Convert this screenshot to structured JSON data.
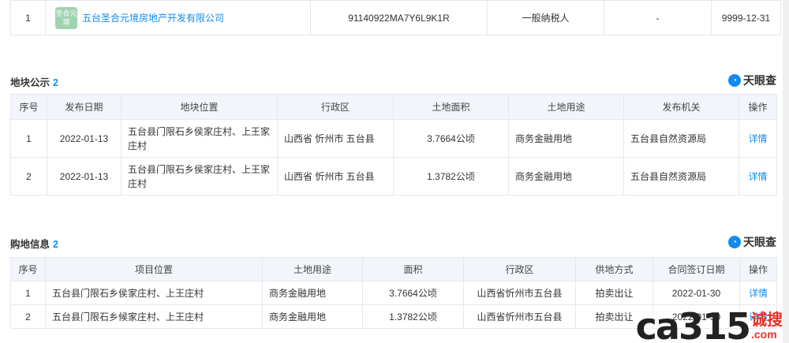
{
  "top_row": {
    "index": "1",
    "logo_text": "圣合元境",
    "company": "五台圣合元境房地产开发有限公司",
    "credit_code": "91140922MA7Y6L9K1R",
    "taxpayer_type": "一般纳税人",
    "col4": "-",
    "valid_until": "9999-12-31"
  },
  "brand": {
    "name": "天眼查"
  },
  "land_notice": {
    "title": "地块公示",
    "count": "2",
    "headers": [
      "序号",
      "发布日期",
      "地块位置",
      "行政区",
      "土地面积",
      "土地用途",
      "发布机关",
      "操作"
    ],
    "rows": [
      {
        "index": "1",
        "date": "2022-01-13",
        "location": "五台县门限石乡侯家庄村、上王家庄村",
        "district": "山西省 忻州市 五台县",
        "area": "3.7664公顷",
        "use": "商务金融用地",
        "authority": "五台县自然资源局",
        "action": "详情"
      },
      {
        "index": "2",
        "date": "2022-01-13",
        "location": "五台县门限石乡侯家庄村、上王家庄村",
        "district": "山西省 忻州市 五台县",
        "area": "1.3782公顷",
        "use": "商务金融用地",
        "authority": "五台县自然资源局",
        "action": "详情"
      }
    ]
  },
  "land_purchase": {
    "title": "购地信息",
    "count": "2",
    "headers": [
      "序号",
      "项目位置",
      "土地用途",
      "面积",
      "行政区",
      "供地方式",
      "合同签订日期",
      "操作"
    ],
    "rows": [
      {
        "index": "1",
        "location": "五台县门限石乡侯家庄村、上王庄村",
        "use": "商务金融用地",
        "area": "3.7664公顷",
        "district": "山西省忻州市五台县",
        "method": "拍卖出让",
        "date": "2022-01-30",
        "action": "详情"
      },
      {
        "index": "2",
        "location": "五台县门限石乡候家庄村、上王庄村",
        "use": "商务金融用地",
        "area": "1.3782公顷",
        "district": "山西省忻州市五台县",
        "method": "拍卖出让",
        "date": "2022-01-30",
        "action": "详情"
      }
    ]
  },
  "watermark": {
    "main": "ca315",
    "cn": "诚搜",
    "com": ".com"
  }
}
